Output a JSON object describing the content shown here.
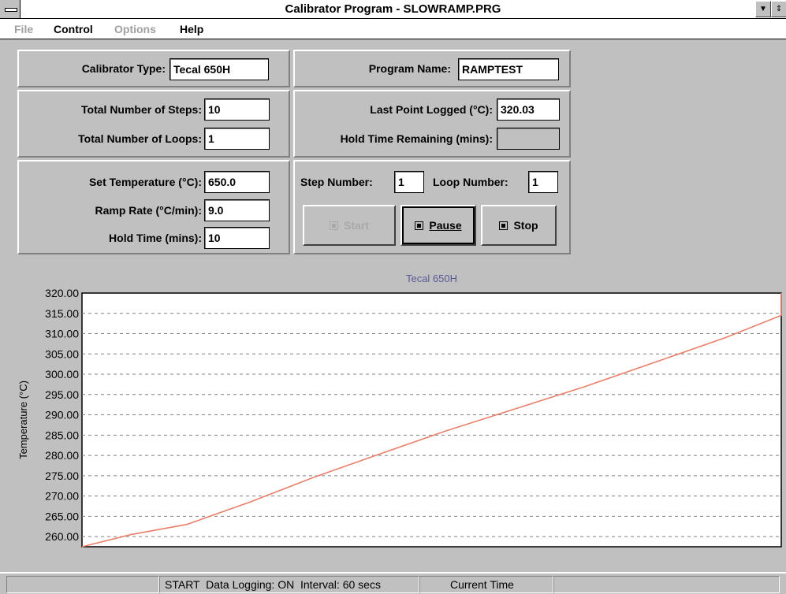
{
  "window": {
    "title": "Calibrator Program - SLOWRAMP.PRG"
  },
  "menu": {
    "items": [
      {
        "label": "File",
        "enabled": false
      },
      {
        "label": "Control",
        "enabled": true
      },
      {
        "label": "Options",
        "enabled": false
      },
      {
        "label": "Help",
        "enabled": true
      }
    ]
  },
  "calibrator": {
    "label": "Calibrator Type:",
    "value": "Tecal 650H"
  },
  "program": {
    "label": "Program Name:",
    "value": "RAMPTEST"
  },
  "steps": {
    "label": "Total Number of Steps:",
    "value": "10"
  },
  "loops": {
    "label": "Total Number of Loops:",
    "value": "1"
  },
  "last_point": {
    "label": "Last Point Logged (°C):",
    "value": "320.03"
  },
  "hold_remaining": {
    "label": "Hold Time Remaining (mins):",
    "value": ""
  },
  "set_temp": {
    "label": "Set Temperature (°C):",
    "value": "650.0"
  },
  "ramp_rate": {
    "label": "Ramp Rate (°C/min):",
    "value": "9.0"
  },
  "hold_time": {
    "label": "Hold Time (mins):",
    "value": "10"
  },
  "step_number": {
    "label": "Step Number:",
    "value": "1"
  },
  "loop_number": {
    "label": "Loop Number:",
    "value": "1"
  },
  "buttons": {
    "start": {
      "label": "Start",
      "enabled": false
    },
    "pause": {
      "label": "Pause",
      "enabled": true
    },
    "stop": {
      "label": "Stop",
      "enabled": true
    }
  },
  "colors": {
    "line": "#e8806a",
    "title": "#5a5a9a",
    "grid": "#808080"
  },
  "chart_data": {
    "type": "line",
    "title": "Tecal 650H",
    "ylabel": "Temperature (°C)",
    "xlabel": "",
    "ylim": [
      257.5,
      320.0
    ],
    "yticks": [
      260.0,
      265.0,
      270.0,
      275.0,
      280.0,
      285.0,
      290.0,
      295.0,
      300.0,
      305.0,
      310.0,
      315.0,
      320.0
    ],
    "ytick_labels": [
      "260.00",
      "265.00",
      "270.00",
      "275.00",
      "280.00",
      "285.00",
      "290.00",
      "295.00",
      "300.00",
      "305.00",
      "310.00",
      "315.00",
      "320.00"
    ],
    "grid": "horizontal dashed",
    "series": [
      {
        "x": [
          0,
          7,
          15,
          24,
          33,
          42,
          52,
          62,
          72,
          82,
          92,
          100
        ],
        "values": [
          257.5,
          260.5,
          263.0,
          268.5,
          274.5,
          280.0,
          286.0,
          291.5,
          297.0,
          303.0,
          309.0,
          314.5
        ]
      }
    ],
    "x_end_value": 320.0
  },
  "status": {
    "mode": "START",
    "logging": "Data Logging: ON",
    "interval": "Interval: 60 secs",
    "time_label": "Current Time"
  }
}
